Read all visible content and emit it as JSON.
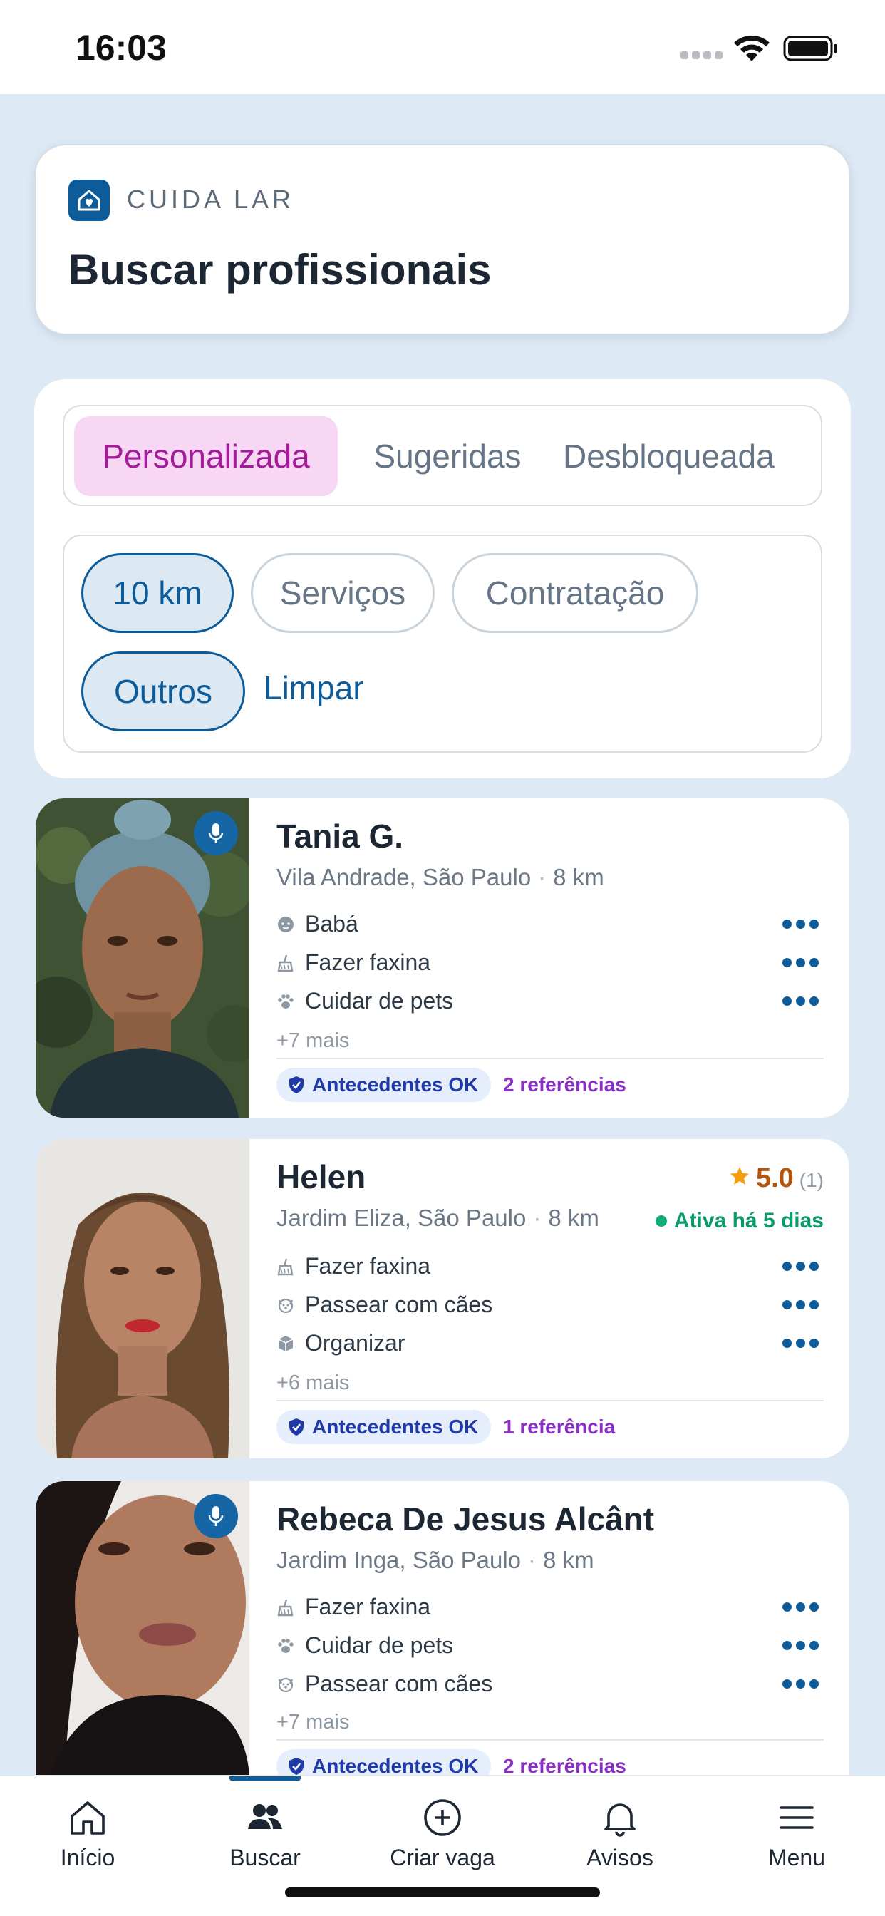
{
  "status_bar": {
    "time": "16:03"
  },
  "header": {
    "brand": "CUIDA LAR",
    "title": "Buscar profissionais"
  },
  "tabs": [
    {
      "label": "Personalizada",
      "active": true
    },
    {
      "label": "Sugeridas",
      "active": false
    },
    {
      "label": "Desbloqueada",
      "active": false
    }
  ],
  "filters": {
    "chips": [
      {
        "label": "10 km",
        "active": true
      },
      {
        "label": "Serviços",
        "active": false
      },
      {
        "label": "Contratação",
        "active": false
      },
      {
        "label": "Outros",
        "active": true
      }
    ],
    "clear_label": "Limpar"
  },
  "profiles": [
    {
      "name": "Tania G.",
      "neighborhood": "Vila Andrade, São Paulo",
      "distance": "8 km",
      "has_audio": true,
      "services": [
        {
          "label": "Babá",
          "icon": "baby-icon"
        },
        {
          "label": "Fazer faxina",
          "icon": "cleaning-icon"
        },
        {
          "label": "Cuidar de pets",
          "icon": "paw-icon"
        }
      ],
      "more": "+7 mais",
      "background_check": "Antecedentes OK",
      "references": "2 referências"
    },
    {
      "name": "Helen",
      "neighborhood": "Jardim Eliza, São Paulo",
      "distance": "8 km",
      "rating": "5.0",
      "rating_count": "(1)",
      "activity": "Ativa há 5 dias",
      "services": [
        {
          "label": "Fazer faxina",
          "icon": "cleaning-icon"
        },
        {
          "label": "Passear com cães",
          "icon": "dog-icon"
        },
        {
          "label": "Organizar",
          "icon": "box-icon"
        }
      ],
      "more": "+6 mais",
      "background_check": "Antecedentes OK",
      "references": "1 referência"
    },
    {
      "name": "Rebeca De Jesus Alcânt",
      "neighborhood": "Jardim Inga, São Paulo",
      "distance": "8 km",
      "has_audio": true,
      "services": [
        {
          "label": "Fazer faxina",
          "icon": "cleaning-icon"
        },
        {
          "label": "Cuidar de pets",
          "icon": "paw-icon"
        },
        {
          "label": "Passear com cães",
          "icon": "dog-icon"
        }
      ],
      "more": "+7 mais",
      "background_check": "Antecedentes OK",
      "references": "2 referências"
    }
  ],
  "bottom_nav": [
    {
      "label": "Início",
      "icon": "home-icon"
    },
    {
      "label": "Buscar",
      "icon": "people-icon",
      "active": true
    },
    {
      "label": "Criar vaga",
      "icon": "plus-circle-icon"
    },
    {
      "label": "Avisos",
      "icon": "bell-icon"
    },
    {
      "label": "Menu",
      "icon": "hamburger-icon"
    }
  ],
  "colors": {
    "primary": "#0d5c99",
    "active_tab_bg": "#f8d7f5",
    "active_tab_text": "#a51c9b",
    "rating": "#b45309",
    "online": "#0a9b6a",
    "references": "#8c2fc7"
  }
}
